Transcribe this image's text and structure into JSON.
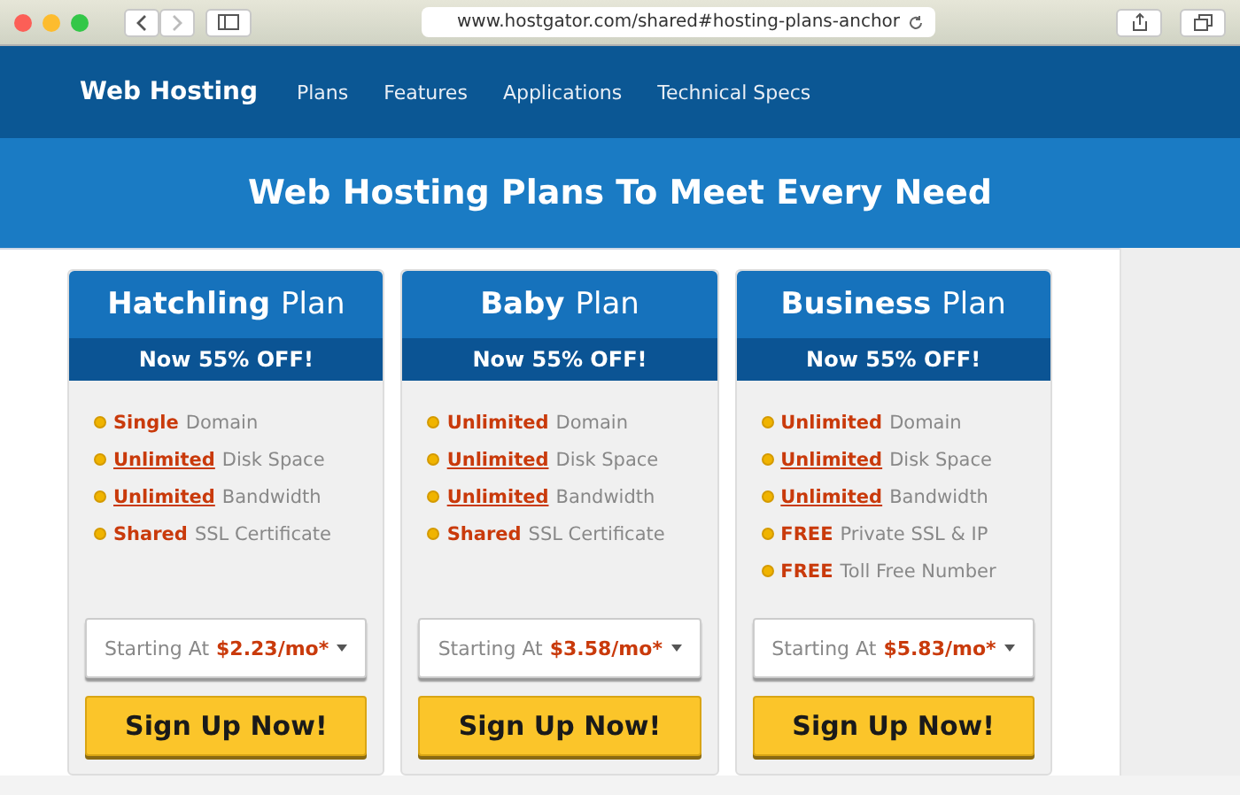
{
  "browser": {
    "url": "www.hostgator.com/shared#hosting-plans-anchor"
  },
  "nav": {
    "brand": "Web Hosting",
    "links": [
      "Plans",
      "Features",
      "Applications",
      "Technical Specs"
    ]
  },
  "hero": {
    "title": "Web Hosting Plans To Meet Every Need"
  },
  "plans": [
    {
      "name": "Hatchling",
      "suffix": "Plan",
      "offer": "Now 55% OFF!",
      "features": [
        {
          "highlight": "Single",
          "rest": "Domain",
          "underlined": false
        },
        {
          "highlight": "Unlimited",
          "rest": "Disk Space",
          "underlined": true
        },
        {
          "highlight": "Unlimited",
          "rest": "Bandwidth",
          "underlined": true
        },
        {
          "highlight": "Shared",
          "rest": "SSL Certificate",
          "underlined": false
        }
      ],
      "price_label": "Starting At",
      "price": "$2.23/mo*",
      "button": "Sign Up Now!"
    },
    {
      "name": "Baby",
      "suffix": "Plan",
      "offer": "Now 55% OFF!",
      "features": [
        {
          "highlight": "Unlimited",
          "rest": "Domain",
          "underlined": false
        },
        {
          "highlight": "Unlimited",
          "rest": "Disk Space",
          "underlined": true
        },
        {
          "highlight": "Unlimited",
          "rest": "Bandwidth",
          "underlined": true
        },
        {
          "highlight": "Shared",
          "rest": "SSL Certificate",
          "underlined": false
        }
      ],
      "price_label": "Starting At",
      "price": "$3.58/mo*",
      "button": "Sign Up Now!"
    },
    {
      "name": "Business",
      "suffix": "Plan",
      "offer": "Now 55% OFF!",
      "features": [
        {
          "highlight": "Unlimited",
          "rest": "Domain",
          "underlined": false
        },
        {
          "highlight": "Unlimited",
          "rest": "Disk Space",
          "underlined": true
        },
        {
          "highlight": "Unlimited",
          "rest": "Bandwidth",
          "underlined": true
        },
        {
          "highlight": "FREE",
          "rest": "Private SSL & IP",
          "underlined": false
        },
        {
          "highlight": "FREE",
          "rest": "Toll Free Number",
          "underlined": false
        }
      ],
      "price_label": "Starting At",
      "price": "$5.83/mo*",
      "button": "Sign Up Now!"
    }
  ]
}
